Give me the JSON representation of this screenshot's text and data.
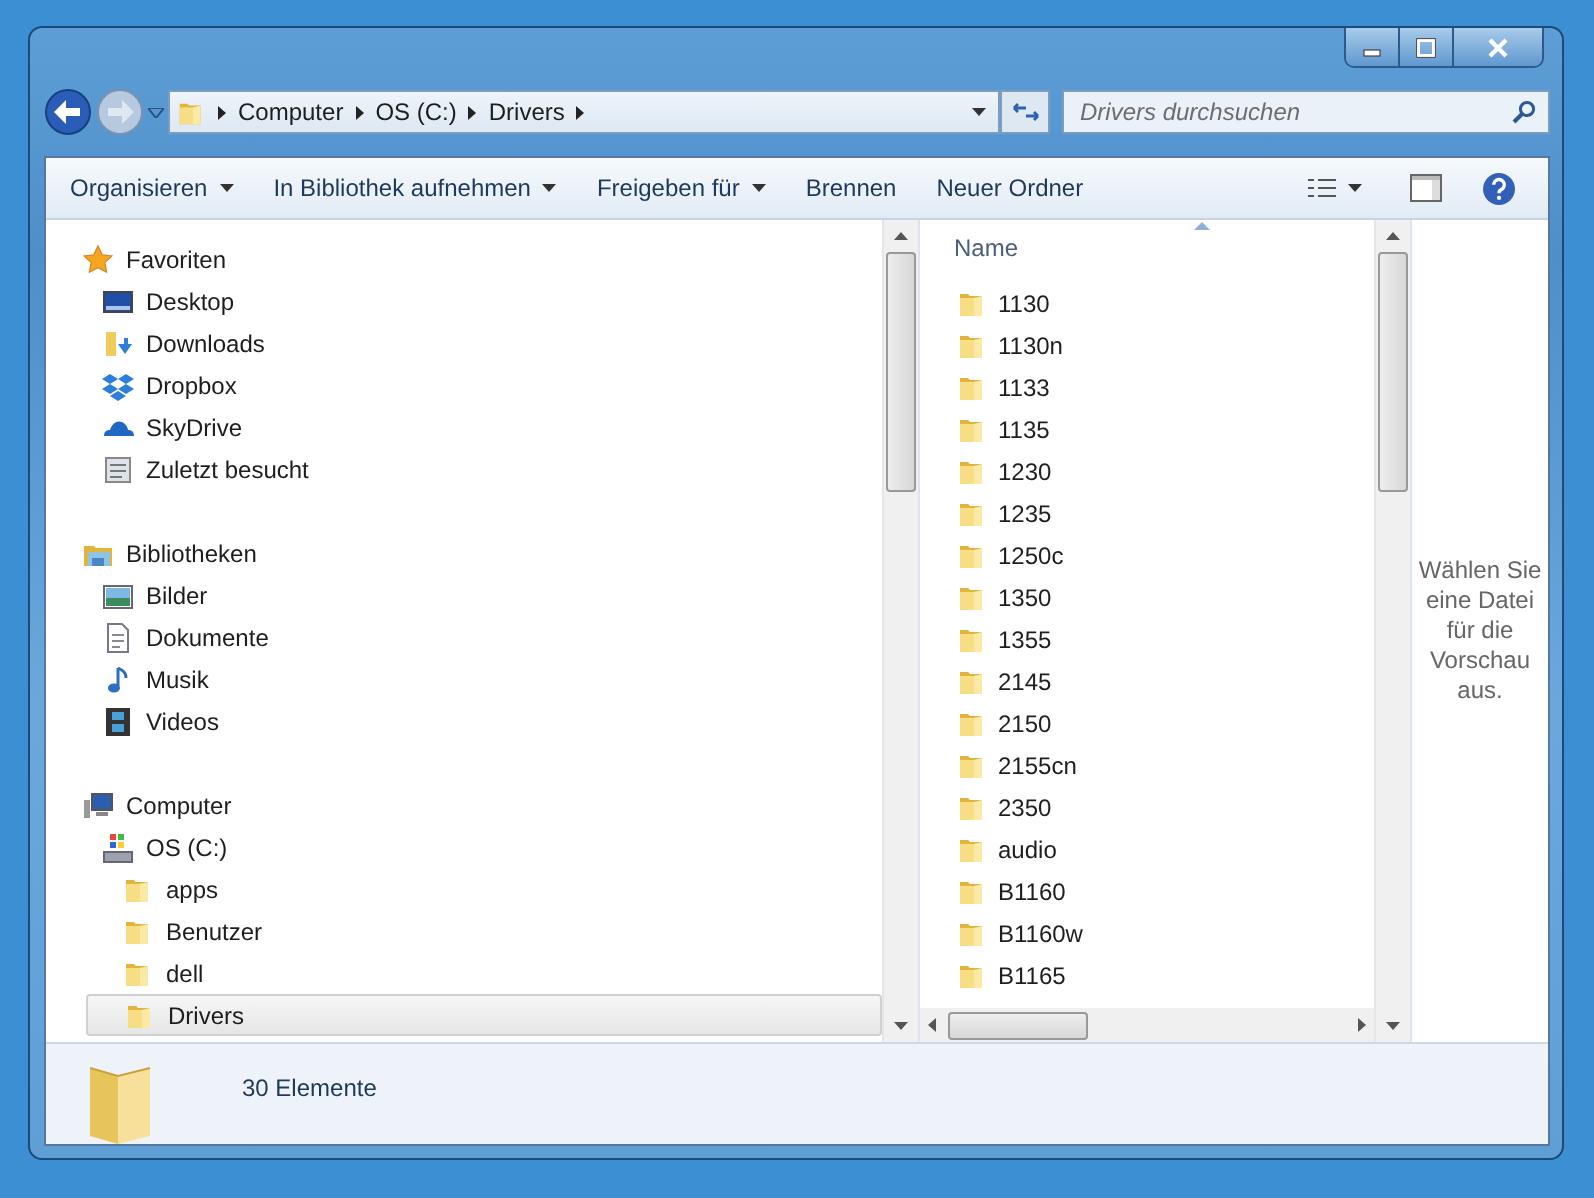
{
  "address": {
    "crumbs": [
      "Computer",
      "OS (C:)",
      "Drivers"
    ]
  },
  "search": {
    "placeholder": "Drivers durchsuchen"
  },
  "toolbar": {
    "items": [
      {
        "label": "Organisieren",
        "dropdown": true
      },
      {
        "label": "In Bibliothek aufnehmen",
        "dropdown": true
      },
      {
        "label": "Freigeben für",
        "dropdown": true
      },
      {
        "label": "Brennen",
        "dropdown": false
      },
      {
        "label": "Neuer Ordner",
        "dropdown": false
      }
    ]
  },
  "sidebar": {
    "groups": [
      {
        "label": "Favoriten",
        "selected": false,
        "children": [
          {
            "label": "Desktop",
            "selected": false
          },
          {
            "label": "Downloads",
            "selected": false
          },
          {
            "label": "Dropbox",
            "selected": false
          },
          {
            "label": "SkyDrive",
            "selected": false
          },
          {
            "label": "Zuletzt besucht",
            "selected": false
          }
        ]
      },
      {
        "label": "Bibliotheken",
        "selected": false,
        "children": [
          {
            "label": "Bilder",
            "selected": false
          },
          {
            "label": "Dokumente",
            "selected": false
          },
          {
            "label": "Musik",
            "selected": false
          },
          {
            "label": "Videos",
            "selected": false
          }
        ]
      },
      {
        "label": "Computer",
        "selected": false,
        "children": [
          {
            "label": "OS (C:)",
            "selected": false,
            "children": [
              {
                "label": "apps",
                "selected": false
              },
              {
                "label": "Benutzer",
                "selected": false
              },
              {
                "label": "dell",
                "selected": false
              },
              {
                "label": "Drivers",
                "selected": true
              }
            ]
          }
        ]
      }
    ]
  },
  "file_list": {
    "column": "Name",
    "files": [
      "1130",
      "1130n",
      "1133",
      "1135",
      "1230",
      "1235",
      "1250c",
      "1350",
      "1355",
      "2145",
      "2150",
      "2155cn",
      "2350",
      "audio",
      "B1160",
      "B1160w",
      "B1165"
    ]
  },
  "preview": {
    "message": "Wählen Sie eine Datei für die Vorschau aus."
  },
  "status_bar": {
    "count": "30 Elemente"
  }
}
